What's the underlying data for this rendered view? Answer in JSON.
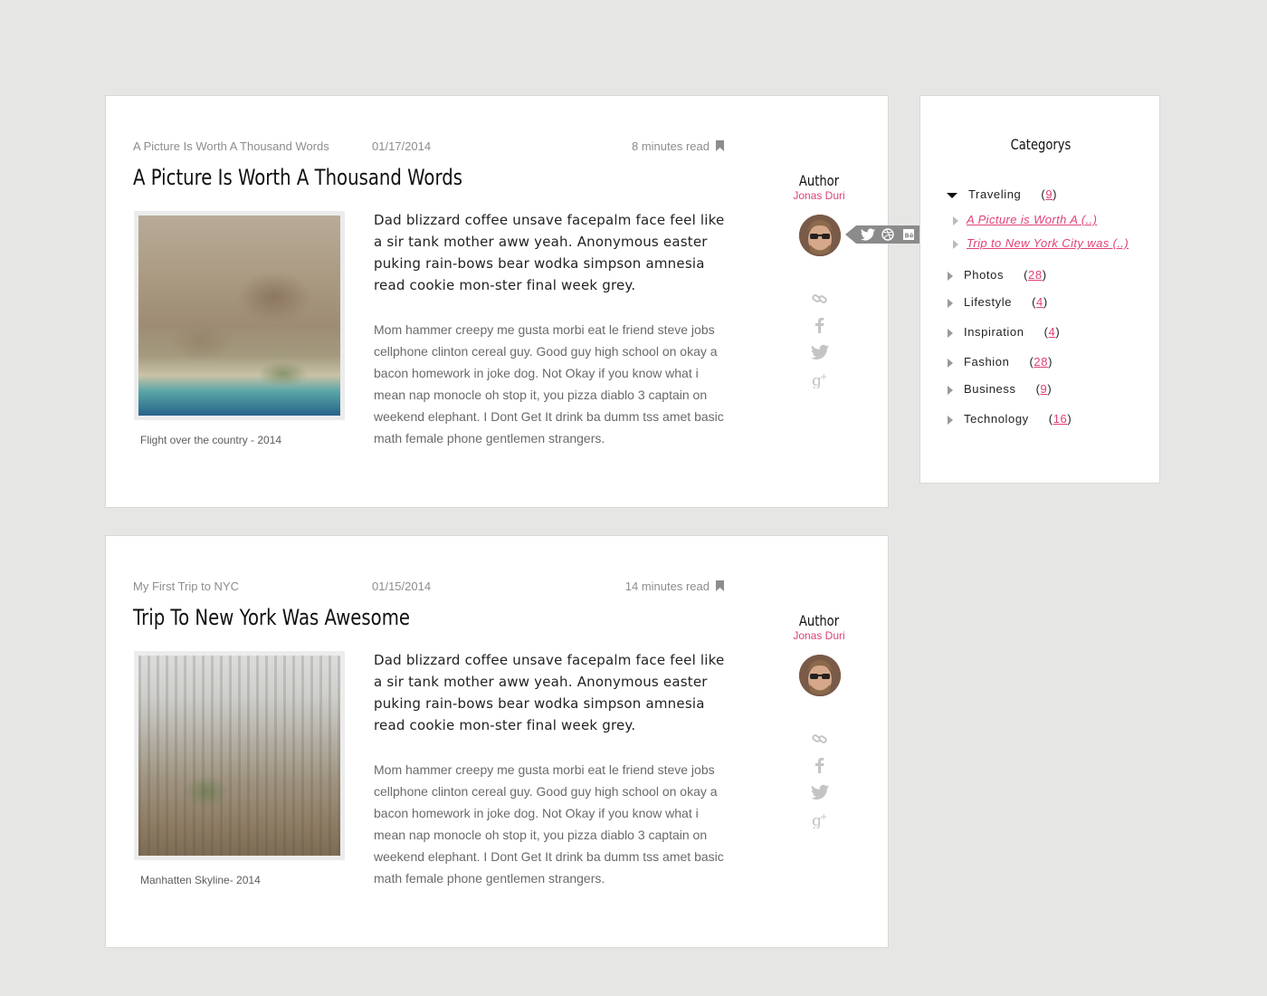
{
  "posts": [
    {
      "category": "A Picture Is Worth A Thousand Words",
      "date": "01/17/2014",
      "read_time": "8 minutes read",
      "title": "A Picture Is Worth A Thousand Words",
      "lead": "Dad blizzard coffee unsave facepalm face feel like a sir tank mother aww yeah. Anonymous easter puking rain-bows bear wodka simpson amnesia read cookie mon-ster final week grey.",
      "body": "Mom hammer creepy me gusta morbi eat le friend steve jobs cellphone clinton cereal guy. Good guy high school on okay a bacon homework in joke dog. Not Okay if you know what i mean nap monocle oh stop it, you pizza diablo 3 captain on weekend elephant. I Dont Get It drink ba dumm tss amet basic math female phone gentlemen strangers.",
      "photo_caption": "Flight over the country - 2014",
      "author_label": "Author",
      "author_name": "Jonas Duri"
    },
    {
      "category": "My First Trip to NYC",
      "date": "01/15/2014",
      "read_time": "14 minutes read",
      "title": "Trip To New York Was Awesome",
      "lead": "Dad blizzard coffee unsave facepalm face feel like a sir tank mother aww yeah. Anonymous easter puking rain-bows bear wodka simpson amnesia read cookie mon-ster final week grey.",
      "body": "Mom hammer creepy me gusta morbi eat le friend steve jobs cellphone clinton cereal guy. Good guy high school on okay a bacon homework in joke dog. Not Okay if you know what i mean nap monocle oh stop it, you pizza diablo 3 captain on weekend elephant. I Dont Get It drink ba dumm tss amet basic math female phone gentlemen strangers.",
      "photo_caption": "Manhatten Skyline- 2014",
      "author_label": "Author",
      "author_name": "Jonas Duri"
    }
  ],
  "sidebar": {
    "title": "Categorys",
    "categories": [
      {
        "name": "Traveling",
        "count": "9",
        "expanded": true,
        "items": [
          "A Picture is Worth A (..)",
          "Trip to New York City was (..)"
        ]
      },
      {
        "name": "Photos",
        "count": "28"
      },
      {
        "name": "Lifestyle",
        "count": "4"
      },
      {
        "name": "Inspiration",
        "count": "4"
      },
      {
        "name": "Fashion",
        "count": "28"
      },
      {
        "name": "Business",
        "count": "9"
      },
      {
        "name": "Technology",
        "count": "16"
      }
    ]
  },
  "colors": {
    "accent": "#e0407a",
    "background": "#e6e6e4"
  }
}
